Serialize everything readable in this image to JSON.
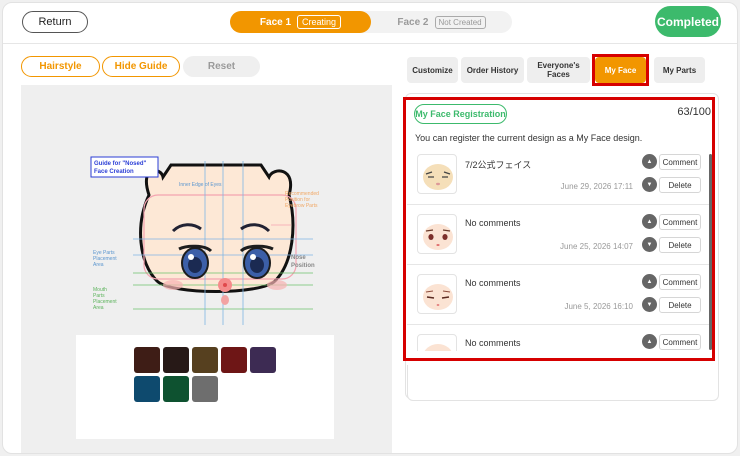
{
  "topbar": {
    "return_label": "Return",
    "face1_label": "Face 1",
    "face1_status": "Creating",
    "face2_label": "Face 2",
    "face2_status": "Not Created",
    "completed_label": "Completed"
  },
  "left": {
    "hairstyle_label": "Hairstyle",
    "hide_guide_label": "Hide Guide",
    "reset_label": "Reset",
    "guide": {
      "title_line1": "Guide for \"Nosed\"",
      "title_line2": "Face Creation",
      "inner_edge": "Inner Edge of Eyes",
      "eyebrow_line1": "Recommended",
      "eyebrow_line2": "Position for",
      "eyebrow_line3": "Eyebrow Parts",
      "eye_area_line1": "Eye Parts",
      "eye_area_line2": "Placement",
      "eye_area_line3": "Area",
      "nose_line1": "Nose",
      "nose_line2": "Position",
      "mouth_line1": "Mouth",
      "mouth_line2": "Parts",
      "mouth_line3": "Placement",
      "mouth_line4": "Area"
    },
    "swatches": [
      "#3e1d16",
      "#271917",
      "#56401f",
      "#6e1616",
      "#3d2b53",
      "#0e4a6e",
      "#0e5230",
      "#6e6e6e"
    ]
  },
  "tabs": [
    {
      "label": "Customize"
    },
    {
      "label": "Order History"
    },
    {
      "label_line1": "Everyone's",
      "label_line2": "Faces"
    },
    {
      "label": "My Face",
      "active": true
    },
    {
      "label": "My Parts"
    }
  ],
  "myface": {
    "registration_label": "My Face Registration",
    "count": "63/100",
    "description": "You can register the current design as a My Face design.",
    "entries": [
      {
        "comment": "7/2公式フェイス",
        "date": "June 29, 2026 17:11"
      },
      {
        "comment": "No comments",
        "date": "June 25, 2026 14:07"
      },
      {
        "comment": "No comments",
        "date": "June 5, 2026 16:10"
      },
      {
        "comment": "No comments",
        "date": ""
      }
    ],
    "comment_button": "Comment",
    "delete_button": "Delete",
    "up_icon": "triangle-up-icon",
    "down_icon": "triangle-down-icon"
  },
  "colors": {
    "accent": "#f29600",
    "success": "#3cba6c",
    "highlight": "#d60000"
  }
}
